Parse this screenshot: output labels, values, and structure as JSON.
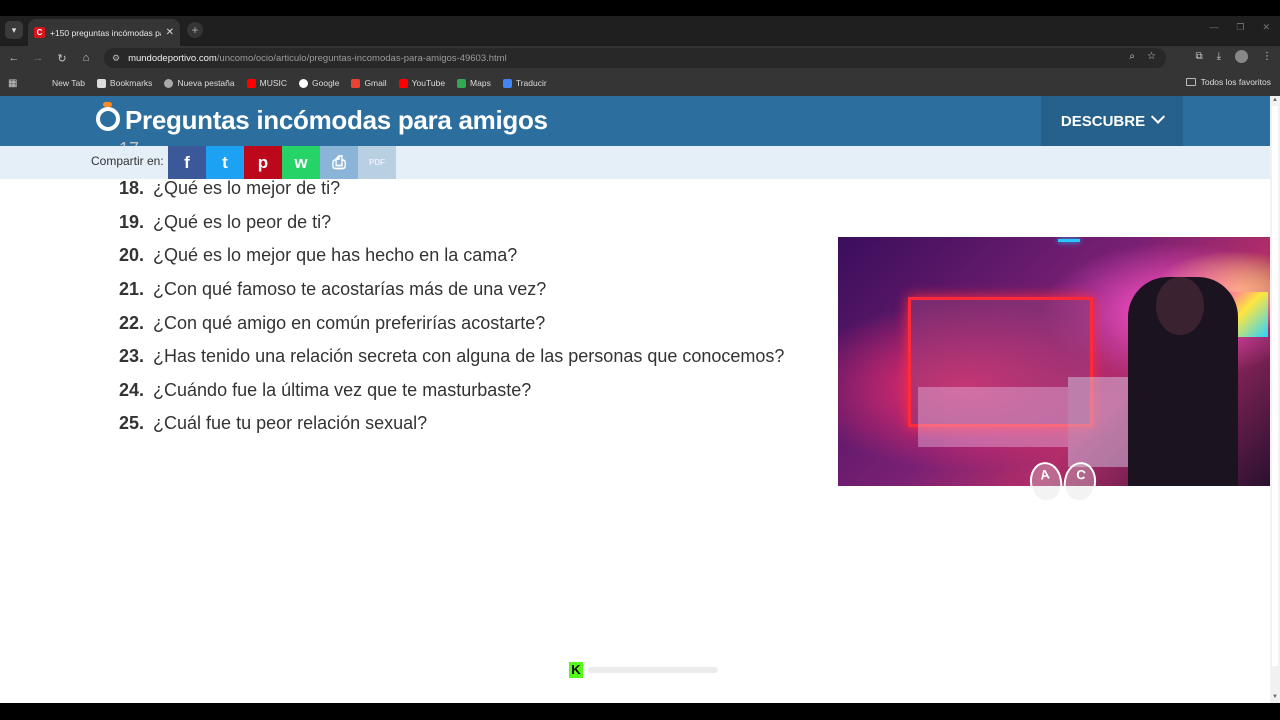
{
  "browser": {
    "tab_title": "+150 preguntas incómodas pa",
    "favicon_letter": "C",
    "url_host": "mundodeportivo.com",
    "url_path": "/uncomo/ocio/articulo/preguntas-incomodas-para-amigos-49603.html",
    "bookmarks": [
      {
        "label": "New Tab",
        "icon": "none",
        "color": ""
      },
      {
        "label": "Bookmarks",
        "icon": "star-icon",
        "color": "#dcdcdc"
      },
      {
        "label": "Nueva pestaña",
        "icon": "globe-icon",
        "color": "#aaaaaa"
      },
      {
        "label": "MUSIC",
        "icon": "youtube-icon",
        "color": "#ff0000"
      },
      {
        "label": "Google",
        "icon": "google-icon",
        "color": "#ffffff"
      },
      {
        "label": "Gmail",
        "icon": "gmail-icon",
        "color": "#ea4335"
      },
      {
        "label": "YouTube",
        "icon": "youtube-icon",
        "color": "#ff0000"
      },
      {
        "label": "Maps",
        "icon": "maps-icon",
        "color": "#34a853"
      },
      {
        "label": "Traducir",
        "icon": "translate-icon",
        "color": "#4285f4"
      }
    ],
    "favorites_label": "Todos los favoritos"
  },
  "page": {
    "title": "Preguntas incómodas para amigos",
    "descubre_label": "DESCUBRE",
    "share_label": "Compartir en:",
    "share_buttons": [
      {
        "name": "facebook-share-button",
        "glyph": "f",
        "color": "#3b5998"
      },
      {
        "name": "twitter-share-button",
        "glyph": "t",
        "color": "#1da1f2"
      },
      {
        "name": "pinterest-share-button",
        "glyph": "p",
        "color": "#bd081c"
      },
      {
        "name": "whatsapp-share-button",
        "glyph": "w",
        "color": "#25d366"
      },
      {
        "name": "print-button",
        "glyph": "⎙",
        "color": "#8ab4d8"
      },
      {
        "name": "pdf-button",
        "glyph": "PDF",
        "color": "#b9cfe2"
      }
    ],
    "questions": [
      {
        "num": "18.",
        "text": "¿Qué es lo mejor de ti?"
      },
      {
        "num": "19.",
        "text": "¿Qué es lo peor de ti?"
      },
      {
        "num": "20.",
        "text": "¿Qué es lo mejor que has hecho en la cama?"
      },
      {
        "num": "21.",
        "text": "¿Con qué famoso te acostarías más de una vez?"
      },
      {
        "num": "22.",
        "text": "¿Con qué amigo en común preferirías acostarte?"
      },
      {
        "num": "23.",
        "text": "¿Has tenido una relación secreta con alguna de las personas que conocemos?"
      },
      {
        "num": "24.",
        "text": "¿Cuándo fue la última vez que te masturbaste?"
      },
      {
        "num": "25.",
        "text": "¿Cuál fue tu peor relación sexual?"
      }
    ]
  },
  "overlay": {
    "sticker_letters": [
      "A",
      "C"
    ],
    "kick_logo": "K"
  },
  "colors": {
    "header_bg": "#2c6e9e",
    "accent_orange": "#ff8a1f"
  }
}
